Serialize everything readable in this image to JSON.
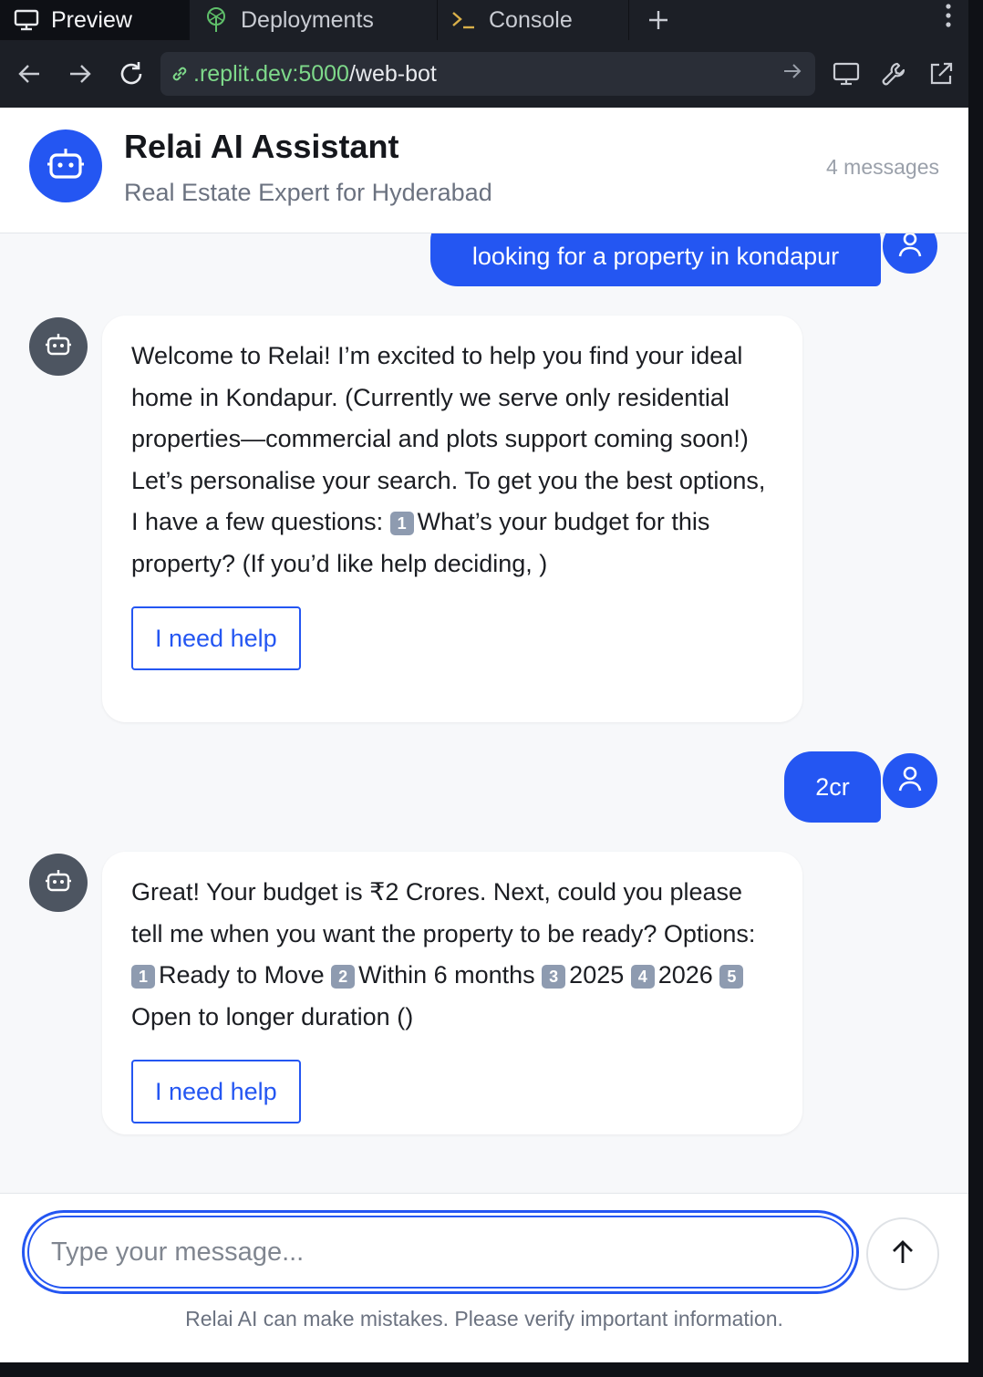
{
  "tabs": [
    {
      "label": "Preview",
      "icon": "monitor-icon"
    },
    {
      "label": "Deployments",
      "icon": "deploy-icon"
    },
    {
      "label": "Console",
      "icon": "terminal-icon"
    }
  ],
  "address": {
    "host": ".replit.dev:5000",
    "path": "/web-bot"
  },
  "header": {
    "title": "Relai AI Assistant",
    "subtitle": "Real Estate Expert for Hyderabad",
    "count": "4 messages"
  },
  "messages": {
    "user1": "looking for a property in kondapur",
    "bot1": {
      "text_a": "Welcome to Relai! I’m excited to help you find your ideal home in Kondapur. (Currently we serve only residential properties—commercial and plots support coming soon!) Let’s personalise your search. To get you the best options, I have a few questions: ",
      "k1": "1",
      "text_b": "What’s your budget for this property? (If you’d like help deciding, )",
      "help": "I need help"
    },
    "user2": "2cr",
    "bot2": {
      "text_a": "Great! Your budget is ₹2 Crores. Next, could you please tell me when you want the property to be ready? Options: ",
      "k1": "1",
      "o1": "Ready to Move ",
      "k2": "2",
      "o2": "Within 6 months ",
      "k3": "3",
      "o3": "2025 ",
      "k4": "4",
      "o4": "2026 ",
      "k5": "5",
      "o5": "Open to longer duration ()",
      "help": "I need help"
    }
  },
  "composer": {
    "placeholder": "Type your message...",
    "disclaimer": "Relai AI can make mistakes. Please verify important information."
  },
  "colors": {
    "accent": "#2456f2",
    "bot_avatar": "#4d5561",
    "chrome_bg": "#1c1f26"
  }
}
